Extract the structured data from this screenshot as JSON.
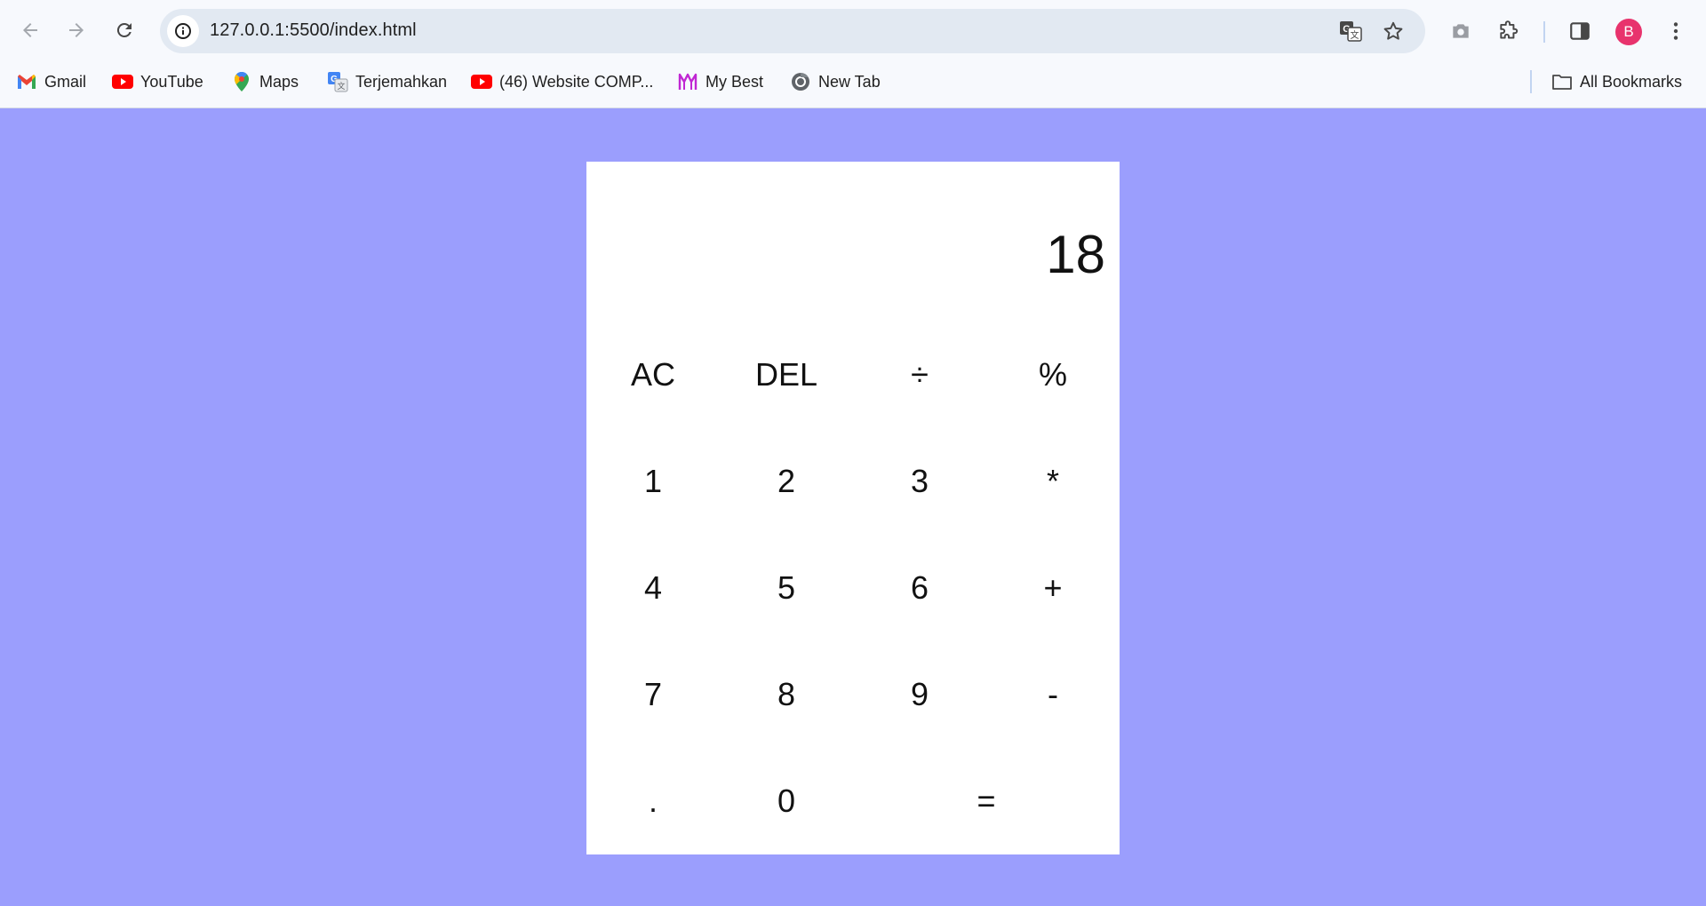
{
  "browser": {
    "url": "127.0.0.1:5500/index.html",
    "avatar_letter": "B",
    "colors": {
      "page_background": "#9b9efd",
      "avatar": "#e8336d",
      "omnibox": "#e2e9f2"
    }
  },
  "bookmarks": [
    {
      "label": "Gmail",
      "icon": "gmail-icon"
    },
    {
      "label": "YouTube",
      "icon": "youtube-icon"
    },
    {
      "label": "Maps",
      "icon": "maps-icon"
    },
    {
      "label": "Terjemahkan",
      "icon": "translate-icon"
    },
    {
      "label": "(46) Website COMP...",
      "icon": "youtube-icon"
    },
    {
      "label": "My Best",
      "icon": "mybest-icon"
    },
    {
      "label": "New Tab",
      "icon": "chrome-icon"
    }
  ],
  "all_bookmarks_label": "All Bookmarks",
  "calculator": {
    "display": "18",
    "rows": [
      [
        "AC",
        "DEL",
        "÷",
        "%"
      ],
      [
        "1",
        "2",
        "3",
        "*"
      ],
      [
        "4",
        "5",
        "6",
        "+"
      ],
      [
        "7",
        "8",
        "9",
        "-"
      ],
      [
        ".",
        "0",
        "="
      ]
    ]
  }
}
